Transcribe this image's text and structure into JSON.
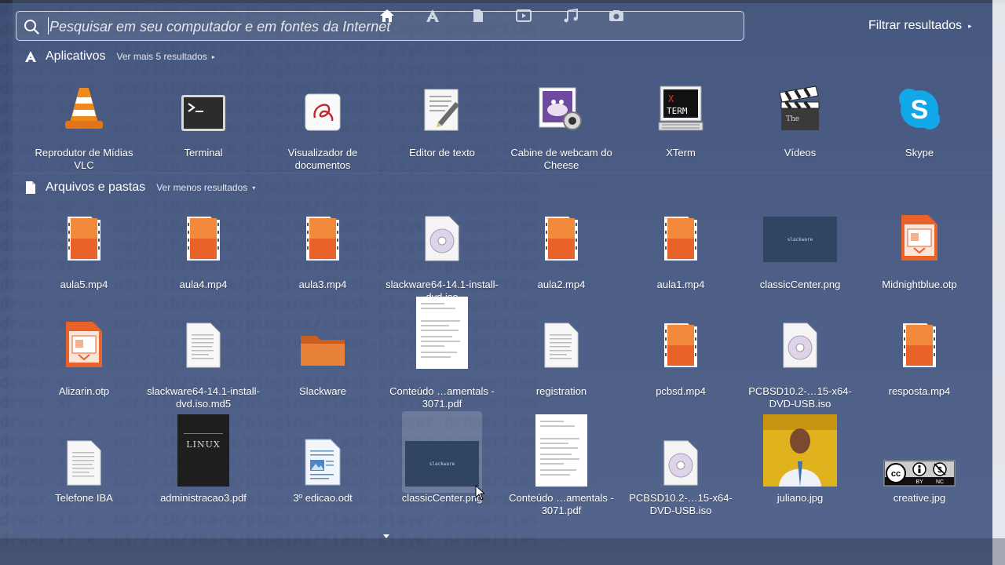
{
  "search": {
    "placeholder": "Pesquisar em seu computador e em fontes da Internet"
  },
  "filter": {
    "label": "Filtrar resultados"
  },
  "apps_section": {
    "title": "Aplicativos",
    "more_label": "Ver mais 5 resultados",
    "items": [
      {
        "label": "Reprodutor de Mídias VLC",
        "icon": "vlc-icon"
      },
      {
        "label": "Terminal",
        "icon": "terminal-icon"
      },
      {
        "label": "Visualizador de documentos",
        "icon": "document-viewer-icon"
      },
      {
        "label": "Editor de texto",
        "icon": "text-editor-icon"
      },
      {
        "label": "Cabine de webcam do Cheese",
        "icon": "cheese-webcam-icon"
      },
      {
        "label": "XTerm",
        "icon": "xterm-icon"
      },
      {
        "label": "Vídeos",
        "icon": "videos-clapperboard-icon"
      },
      {
        "label": "Skype",
        "icon": "skype-icon"
      }
    ]
  },
  "files_section": {
    "title": "Arquivos e pastas",
    "more_label": "Ver menos resultados",
    "rows": [
      [
        {
          "label": "aula5.mp4",
          "icon": "video-file-icon"
        },
        {
          "label": "aula4.mp4",
          "icon": "video-file-icon"
        },
        {
          "label": "aula3.mp4",
          "icon": "video-file-icon"
        },
        {
          "label": "slackware64-14.1-install-dvd.iso",
          "icon": "disc-image-icon"
        },
        {
          "label": "aula2.mp4",
          "icon": "video-file-icon"
        },
        {
          "label": "aula1.mp4",
          "icon": "video-file-icon"
        },
        {
          "label": "classicCenter.png",
          "icon": "image-thumbnail-icon",
          "thumb_text": "slackware"
        },
        {
          "label": "Midnightblue.otp",
          "icon": "presentation-template-icon"
        }
      ],
      [
        {
          "label": "Alizarin.otp",
          "icon": "presentation-template-icon"
        },
        {
          "label": "slackware64-14.1-install-dvd.iso.md5",
          "icon": "text-file-icon"
        },
        {
          "label": "Slackware",
          "icon": "folder-icon"
        },
        {
          "label": "Conteúdo …amentals - 3071.pdf",
          "icon": "pdf-thumbnail-icon"
        },
        {
          "label": "registration",
          "icon": "text-file-icon"
        },
        {
          "label": "pcbsd.mp4",
          "icon": "video-file-icon"
        },
        {
          "label": "PCBSD10.2-…15-x64-DVD-USB.iso",
          "icon": "disc-image-icon"
        },
        {
          "label": "resposta.mp4",
          "icon": "video-file-icon"
        }
      ],
      [
        {
          "label": "Telefone IBA",
          "icon": "text-file-icon"
        },
        {
          "label": "administracao3.pdf",
          "icon": "book-cover-icon",
          "thumb_text": "LINUX"
        },
        {
          "label": "3º edicao.odt",
          "icon": "writer-document-icon"
        },
        {
          "label": "classicCenter.png",
          "icon": "image-thumbnail-icon",
          "thumb_text": "slackware",
          "selected": true
        },
        {
          "label": "Conteúdo …amentals - 3071.pdf",
          "icon": "pdf-thumbnail-icon"
        },
        {
          "label": "PCBSD10.2-…15-x64-DVD-USB.iso",
          "icon": "disc-image-icon"
        },
        {
          "label": "juliano.jpg",
          "icon": "photo-thumbnail-icon"
        },
        {
          "label": "creative.jpg",
          "icon": "creative-commons-badge-icon"
        }
      ]
    ]
  },
  "launcher": {
    "lenses": [
      "home-icon",
      "applications-icon",
      "files-icon",
      "video-icon",
      "music-icon",
      "photo-icon"
    ],
    "active": "home-icon"
  },
  "colors": {
    "video_orange": "#e8622a",
    "folder_orange": "#e07a3a",
    "dash_overlay": "#50648c"
  }
}
